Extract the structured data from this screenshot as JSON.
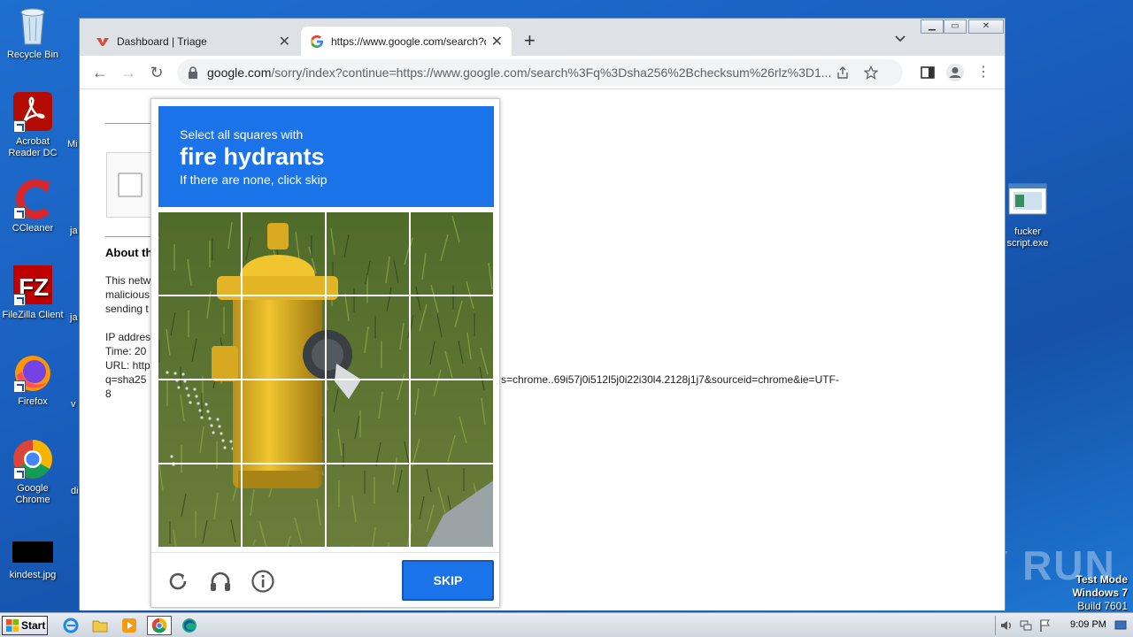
{
  "desktop": {
    "icons": [
      {
        "label": "Recycle Bin"
      },
      {
        "label": "Acrobat Reader DC"
      },
      {
        "label": "CCleaner"
      },
      {
        "label": "FileZilla Client"
      },
      {
        "label": "Firefox"
      },
      {
        "label": "Google Chrome"
      },
      {
        "label": "kindest.jpg"
      },
      {
        "label": "fucker script.exe"
      }
    ],
    "partial_labels": [
      "Mi",
      "ja",
      "ja",
      "v",
      "di"
    ]
  },
  "watermark": "ANY RUN",
  "system": {
    "test_mode": "Test Mode",
    "os": "Windows 7",
    "build": "Build 7601"
  },
  "browser": {
    "tabs": [
      {
        "title": "Dashboard | Triage",
        "active": false
      },
      {
        "title": "https://www.google.com/search?q=",
        "active": true
      }
    ],
    "url_host": "google.com",
    "url_path": "/sorry/index?continue=https://www.google.com/search%3Fq%3Dsha256%2Bchecksum%26rlz%3D1..."
  },
  "page": {
    "about_title": "About th",
    "body_lines": [
      "This netw",
      "malicious",
      "sending t"
    ],
    "info_lines": [
      "IP addres",
      "Time: 20",
      "URL: http"
    ],
    "url_line": "q=sha25",
    "url_tail": "s=chrome..69i57j0i512l5j0i22i30l4.2128j1j7&sourceid=chrome&ie=UTF-",
    "url_end": "8"
  },
  "captcha": {
    "instruction": "Select all squares with",
    "target": "fire hydrants",
    "hint": "If there are none, click skip",
    "skip_label": "SKIP",
    "icons": [
      "reload-icon",
      "audio-icon",
      "info-icon"
    ]
  },
  "taskbar": {
    "start_label": "Start",
    "clock": "9:09 PM"
  }
}
